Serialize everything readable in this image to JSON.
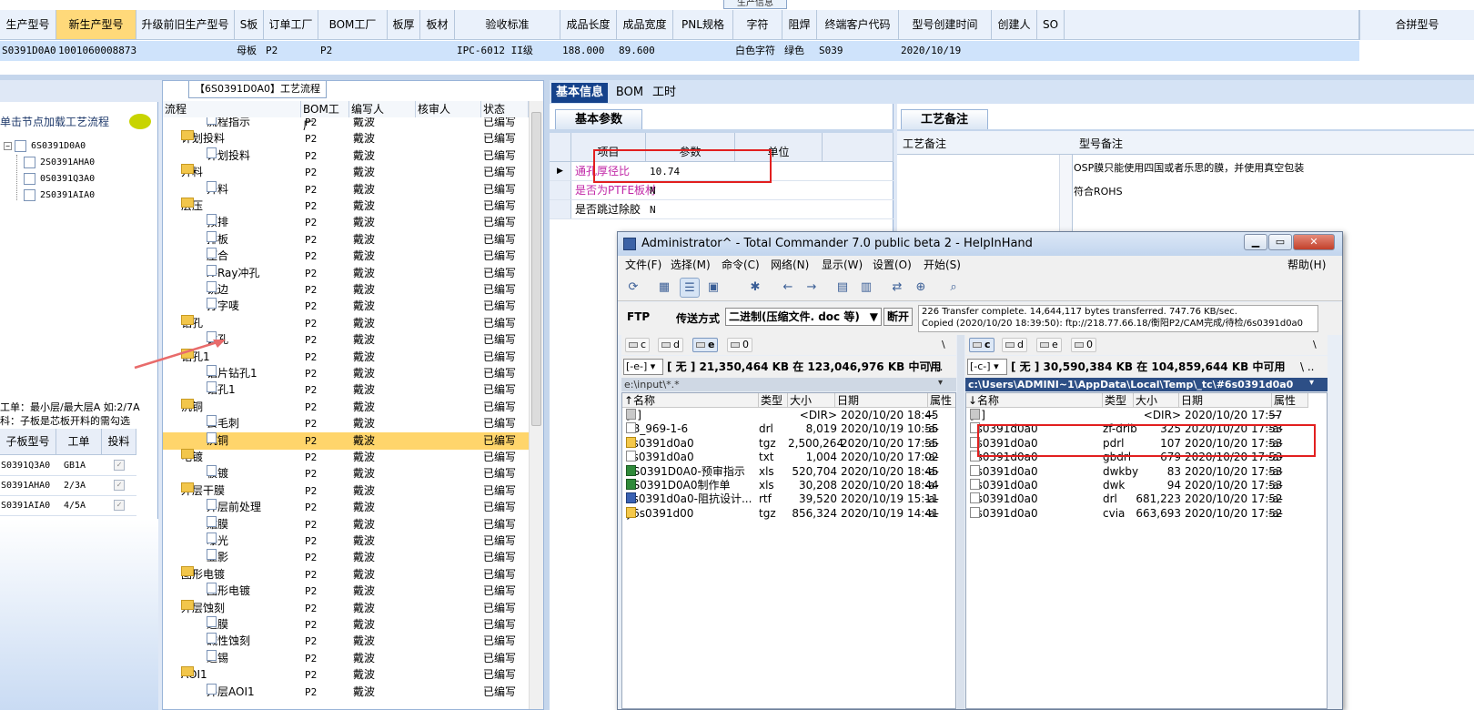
{
  "top_grid": {
    "title_tab": "生产信息",
    "columns": [
      "生产型号",
      "新生产型号",
      "升级前旧生产型号",
      "S板",
      "订单工厂",
      "BOM工厂",
      "板厚",
      "板材",
      "验收标准",
      "成品长度",
      "成品宽度",
      "PNL规格",
      "字符",
      "阻焊",
      "终端客户代码",
      "型号创建时间",
      "创建人",
      "SO"
    ],
    "merge_column": "合拼型号",
    "row": [
      "S0391D0A0",
      "10010600088736",
      "",
      "母板",
      "P2",
      "P2",
      "",
      "",
      "IPC-6012 II级",
      "188.000",
      "89.600",
      "",
      "白色字符",
      "绿色",
      "S039",
      "2020/10/19",
      "",
      ""
    ]
  },
  "left_panel": {
    "hint": "单击节点加载工艺流程",
    "tree_root": "6S0391D0A0",
    "tree_children": [
      "2S0391AHA0",
      "0S0391Q3A0",
      "2S0391AIA0"
    ],
    "note_line1": "工单：最小层/最大层A 如:2/7A",
    "note_line2": "科：子板是芯板开料的需勾选",
    "sub_grid": {
      "headers": [
        "子板型号",
        "工单",
        "投料"
      ],
      "rows": [
        {
          "model": "S0391Q3A0",
          "order": "GB1A",
          "checked": "✓"
        },
        {
          "model": "S0391AHA0",
          "order": "2/3A",
          "checked": "✓"
        },
        {
          "model": "S0391AIA0",
          "order": "4/5A",
          "checked": "✓"
        }
      ]
    }
  },
  "process_panel": {
    "title": "【6S0391D0A0】工艺流程",
    "headers": [
      "流程",
      "BOM工厂",
      "编写人",
      "核审人",
      "状态"
    ],
    "rows": [
      {
        "level": 2,
        "name": "流程指示",
        "factory": "P2",
        "writer": "戴波",
        "reviewer": "",
        "status": "已编写"
      },
      {
        "level": 1,
        "name": "计划投料",
        "factory": "P2",
        "writer": "戴波",
        "reviewer": "",
        "status": "已编写"
      },
      {
        "level": 2,
        "name": "计划投料",
        "factory": "P2",
        "writer": "戴波",
        "reviewer": "",
        "status": "已编写"
      },
      {
        "level": 1,
        "name": "开料",
        "factory": "P2",
        "writer": "戴波",
        "reviewer": "",
        "status": "已编写"
      },
      {
        "level": 2,
        "name": "开料",
        "factory": "P2",
        "writer": "戴波",
        "reviewer": "",
        "status": "已编写"
      },
      {
        "level": 1,
        "name": "层压",
        "factory": "P2",
        "writer": "戴波",
        "reviewer": "",
        "status": "已编写"
      },
      {
        "level": 2,
        "name": "预排",
        "factory": "P2",
        "writer": "戴波",
        "reviewer": "",
        "status": "已编写"
      },
      {
        "level": 2,
        "name": "排板",
        "factory": "P2",
        "writer": "戴波",
        "reviewer": "",
        "status": "已编写"
      },
      {
        "level": 2,
        "name": "压合",
        "factory": "P2",
        "writer": "戴波",
        "reviewer": "",
        "status": "已编写"
      },
      {
        "level": 2,
        "name": "X-Ray冲孔",
        "factory": "P2",
        "writer": "戴波",
        "reviewer": "",
        "status": "已编写"
      },
      {
        "level": 2,
        "name": "铣边",
        "factory": "P2",
        "writer": "戴波",
        "reviewer": "",
        "status": "已编写"
      },
      {
        "level": 2,
        "name": "打字唛",
        "factory": "P2",
        "writer": "戴波",
        "reviewer": "",
        "status": "已编写"
      },
      {
        "level": 1,
        "name": "钻孔",
        "factory": "P2",
        "writer": "戴波",
        "reviewer": "",
        "status": "已编写"
      },
      {
        "level": 2,
        "name": "钻孔",
        "factory": "P2",
        "writer": "戴波",
        "reviewer": "",
        "status": "已编写"
      },
      {
        "level": 1,
        "name": "钻孔1",
        "factory": "P2",
        "writer": "戴波",
        "reviewer": "",
        "status": "已编写"
      },
      {
        "level": 2,
        "name": "铝片钻孔1",
        "factory": "P2",
        "writer": "戴波",
        "reviewer": "",
        "status": "已编写"
      },
      {
        "level": 2,
        "name": "钻孔1",
        "factory": "P2",
        "writer": "戴波",
        "reviewer": "",
        "status": "已编写"
      },
      {
        "level": 1,
        "name": "沉铜",
        "factory": "P2",
        "writer": "戴波",
        "reviewer": "",
        "status": "已编写"
      },
      {
        "level": 2,
        "name": "去毛刺",
        "factory": "P2",
        "writer": "戴波",
        "reviewer": "",
        "status": "已编写"
      },
      {
        "level": 2,
        "name": "沉铜",
        "factory": "P2",
        "writer": "戴波",
        "reviewer": "",
        "status": "已编写",
        "selected": "yes"
      },
      {
        "level": 1,
        "name": "电镀",
        "factory": "P2",
        "writer": "戴波",
        "reviewer": "",
        "status": "已编写"
      },
      {
        "level": 2,
        "name": "板镀",
        "factory": "P2",
        "writer": "戴波",
        "reviewer": "",
        "status": "已编写"
      },
      {
        "level": 1,
        "name": "外层干膜",
        "factory": "P2",
        "writer": "戴波",
        "reviewer": "",
        "status": "已编写"
      },
      {
        "level": 2,
        "name": "外层前处理",
        "factory": "P2",
        "writer": "戴波",
        "reviewer": "",
        "status": "已编写"
      },
      {
        "level": 2,
        "name": "贴膜",
        "factory": "P2",
        "writer": "戴波",
        "reviewer": "",
        "status": "已编写"
      },
      {
        "level": 2,
        "name": "曝光",
        "factory": "P2",
        "writer": "戴波",
        "reviewer": "",
        "status": "已编写"
      },
      {
        "level": 2,
        "name": "显影",
        "factory": "P2",
        "writer": "戴波",
        "reviewer": "",
        "status": "已编写"
      },
      {
        "level": 1,
        "name": "图形电镀",
        "factory": "P2",
        "writer": "戴波",
        "reviewer": "",
        "status": "已编写"
      },
      {
        "level": 2,
        "name": "图形电镀",
        "factory": "P2",
        "writer": "戴波",
        "reviewer": "",
        "status": "已编写"
      },
      {
        "level": 1,
        "name": "外层蚀刻",
        "factory": "P2",
        "writer": "戴波",
        "reviewer": "",
        "status": "已编写"
      },
      {
        "level": 2,
        "name": "退膜",
        "factory": "P2",
        "writer": "戴波",
        "reviewer": "",
        "status": "已编写"
      },
      {
        "level": 2,
        "name": "碱性蚀刻",
        "factory": "P2",
        "writer": "戴波",
        "reviewer": "",
        "status": "已编写"
      },
      {
        "level": 2,
        "name": "退锡",
        "factory": "P2",
        "writer": "戴波",
        "reviewer": "",
        "status": "已编写"
      },
      {
        "level": 1,
        "name": "AOI1",
        "factory": "P2",
        "writer": "戴波",
        "reviewer": "",
        "status": "已编写"
      },
      {
        "level": 2,
        "name": "外层AOI1",
        "factory": "P2",
        "writer": "戴波",
        "reviewer": "",
        "status": "已编写"
      }
    ]
  },
  "main_tabs": [
    "基本信息",
    "BOM",
    "工时"
  ],
  "params_panel": {
    "tab": "基本参数",
    "headers": [
      "项目",
      "参数",
      "单位"
    ],
    "rows": [
      {
        "item": "通孔厚径比",
        "value": "10.74",
        "unit": ""
      },
      {
        "item": "是否为PTFE板材",
        "value": "N",
        "unit": ""
      },
      {
        "item": "是否跳过除胶",
        "value": "N",
        "unit": ""
      }
    ]
  },
  "notes_panel": {
    "tab": "工艺备注",
    "headers": [
      "工艺备注",
      "型号备注"
    ],
    "lines": [
      "OSP膜只能使用四国或者乐思的膜，并使用真空包装",
      "符合ROHS"
    ]
  },
  "total_commander": {
    "title": "Administrator^ - Total Commander 7.0 public beta 2 - HelpInHand",
    "menu": [
      "文件(F)",
      "选择(M)",
      "命令(C)",
      "网络(N)",
      "显示(W)",
      "设置(O)",
      "开始(S)"
    ],
    "help": "帮助(H)",
    "ftp_label": "FTP",
    "transfer_label": "传送方式",
    "transfer_mode": "二进制(压缩文件. doc 等)",
    "disconnect": "断开",
    "ftp_msg1": "226 Transfer complete. 14,644,117 bytes transferred. 747.76 KB/sec.",
    "ftp_msg2": "Copied (2020/10/20 18:39:50): ftp://218.77.66.18/衡阳P2/CAM完成/待检/6s0391d0a0",
    "left": {
      "drives": [
        "c",
        "d",
        "e",
        "0"
      ],
      "drive_sel": "[-e-]",
      "free": "[ 无 ]  21,350,464 KB 在 123,046,976 KB 中可用",
      "path": "e:\\input\\*.*",
      "headers": [
        "↑名称",
        "类型",
        "大小",
        "日期",
        "属性"
      ],
      "files": [
        {
          "name": "[..]",
          "ext": "",
          "size": "<DIR>",
          "date": "2020/10/20 18:45",
          "attr": "—",
          "icon": "up"
        },
        {
          "name": "28_969-1-6",
          "ext": "drl",
          "size": "8,019",
          "date": "2020/10/19 10:55",
          "attr": "-a-",
          "icon": "doc"
        },
        {
          "name": "6s0391d0a0",
          "ext": "tgz",
          "size": "2,500,264",
          "date": "2020/10/20 17:55",
          "attr": "-a-",
          "icon": "tgz"
        },
        {
          "name": "6s0391d0a0",
          "ext": "txt",
          "size": "1,004",
          "date": "2020/10/20 17:02",
          "attr": "-a-",
          "icon": "doc"
        },
        {
          "name": "6S0391D0A0-预审指示",
          "ext": "xls",
          "size": "520,704",
          "date": "2020/10/20 18:45",
          "attr": "-a-",
          "icon": "xls"
        },
        {
          "name": "6S0391D0A0制作单",
          "ext": "xls",
          "size": "30,208",
          "date": "2020/10/20 18:44",
          "attr": "-a-",
          "icon": "xls"
        },
        {
          "name": "6s0391d0a0-阻抗设计...",
          "ext": "rtf",
          "size": "39,520",
          "date": "2020/10/19 15:11",
          "attr": "-a-",
          "icon": "rtf"
        },
        {
          "name": "y6s0391d00",
          "ext": "tgz",
          "size": "856,324",
          "date": "2020/10/19 14:41",
          "attr": "-a-",
          "icon": "tgz"
        }
      ]
    },
    "right": {
      "drives": [
        "c",
        "d",
        "e",
        "0"
      ],
      "drive_sel": "[-c-]",
      "free": "[ 无 ]  30,590,384 KB 在 104,859,644 KB 中可用",
      "path": "c:\\Users\\ADMINI~1\\AppData\\Local\\Temp\\_tc\\#6s0391d0a0",
      "headers": [
        "↓名称",
        "类型",
        "大小",
        "日期",
        "属性"
      ],
      "files": [
        {
          "name": "[..]",
          "ext": "",
          "size": "<DIR>",
          "date": "2020/10/20 17:57",
          "attr": "—",
          "icon": "up"
        },
        {
          "name": "6s0391d0a0",
          "ext": "zf-drlb",
          "size": "325",
          "date": "2020/10/20 17:53",
          "attr": "-a-",
          "icon": "doc"
        },
        {
          "name": "6s0391d0a0",
          "ext": "pdrl",
          "size": "107",
          "date": "2020/10/20 17:53",
          "attr": "-a-",
          "icon": "doc"
        },
        {
          "name": "6s0391d0a0",
          "ext": "gbdrl",
          "size": "679",
          "date": "2020/10/20 17:53",
          "attr": "-a-",
          "icon": "doc"
        },
        {
          "name": "6s0391d0a0",
          "ext": "dwkby",
          "size": "83",
          "date": "2020/10/20 17:53",
          "attr": "-a-",
          "icon": "doc"
        },
        {
          "name": "6s0391d0a0",
          "ext": "dwk",
          "size": "94",
          "date": "2020/10/20 17:53",
          "attr": "-a-",
          "icon": "doc"
        },
        {
          "name": "6s0391d0a0",
          "ext": "drl",
          "size": "681,223",
          "date": "2020/10/20 17:52",
          "attr": "-a-",
          "icon": "doc"
        },
        {
          "name": "6s0391d0a0",
          "ext": "cvia",
          "size": "663,693",
          "date": "2020/10/20 17:52",
          "attr": "-a-",
          "icon": "doc"
        }
      ]
    }
  },
  "colors": {
    "accent": "#15428b",
    "selected_row": "#ffd56b",
    "annotation": "#e21f1f",
    "header_highlight": "#ffd97a"
  }
}
